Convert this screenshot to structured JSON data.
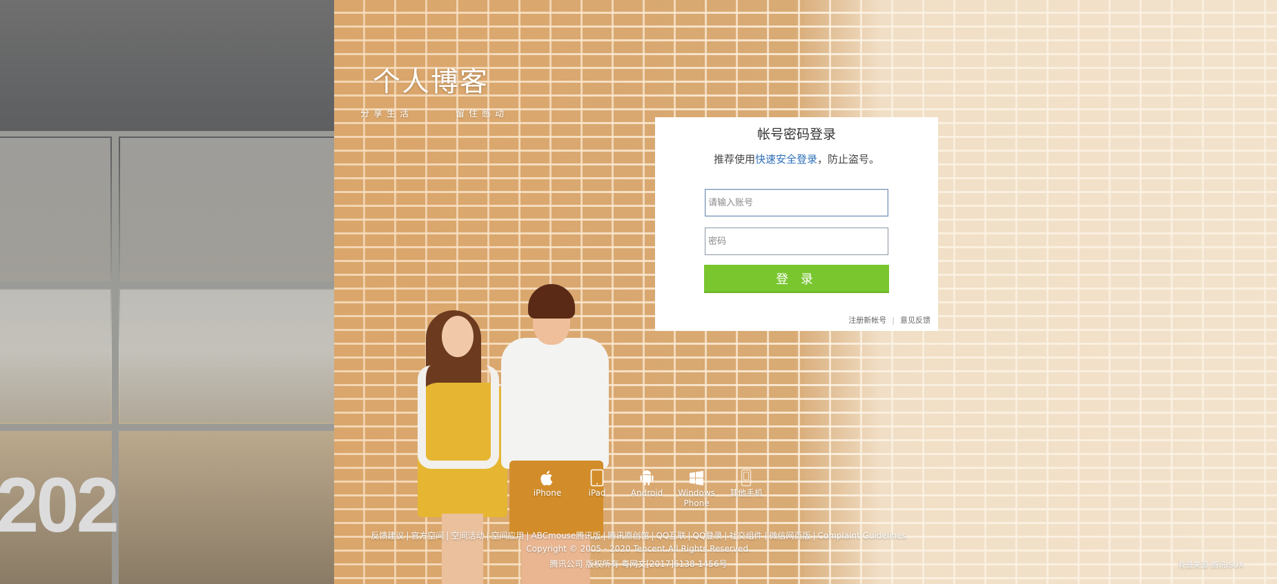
{
  "brand": {
    "title": "个人博客",
    "slogan_left": "分享生活",
    "slogan_right": "留住感动"
  },
  "login": {
    "title": "帐号密码登录",
    "tip_prefix": "推荐使用",
    "tip_link": "快速安全登录",
    "tip_suffix": "，防止盗号。",
    "account_placeholder": "请输入账号",
    "password_placeholder": "密码",
    "submit_label": "登 录",
    "register_link": "注册新帐号",
    "separator": "|",
    "feedback_link": "意见反馈"
  },
  "platforms": [
    {
      "label": "iPhone",
      "icon": "apple-icon"
    },
    {
      "label": "iPad",
      "icon": "tablet-icon"
    },
    {
      "label": "Android",
      "icon": "android-icon"
    },
    {
      "label": "Windows Phone",
      "icon": "windows-icon"
    },
    {
      "label": "其他手机",
      "icon": "phone-icon"
    }
  ],
  "footer": {
    "links": [
      "反馈建议",
      "官方空间",
      "空间活动",
      "空间应用",
      "ABCmouse腾讯版",
      "腾讯原创馆",
      "QQ互联",
      "QQ登录",
      "社交组件",
      "微信网页版",
      "Complaint Guidelines"
    ],
    "link_separator": "|",
    "copyright": "Copyright © 2005 - 2020 Tencent.All Rights Reserved.",
    "license": "腾讯公司 版权所有 粤网文[2017]6138-1456号",
    "credit_left": "背景来源",
    "credit_right": "腾讯ISUX"
  },
  "scene": {
    "building_number": "202"
  }
}
